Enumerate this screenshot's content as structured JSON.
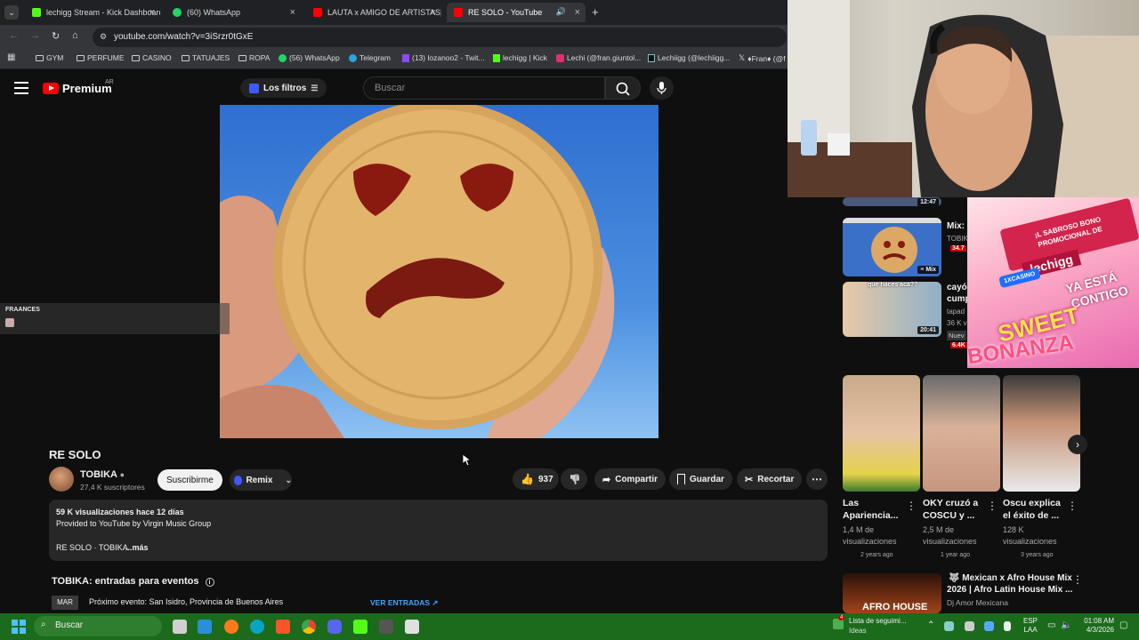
{
  "browser": {
    "tabs": [
      {
        "label": "lechigg Stream - Kick Dashboard"
      },
      {
        "label": "(60) WhatsApp"
      },
      {
        "label": "LAUTA x AMIGO DE ARTISTAS|"
      },
      {
        "label": "RE SOLO - YouTube"
      }
    ],
    "url": "youtube.com/watch?v=3iSrzr0tGxE",
    "bookmarks": [
      "GYM",
      "PERFUME",
      "CASINO",
      "TATUAJES",
      "ROPA",
      "(56) WhatsApp",
      "Telegram",
      "(13) lozanoo2 - Twit...",
      "lechigg | Kick",
      "Lechi (@fran.giuntol...",
      "Lechiigg (@lechiigg...",
      "♦Fran♦ (@f"
    ]
  },
  "youtube": {
    "logo": "Premium",
    "country": "AR",
    "filters_label": "Los filtros",
    "search_placeholder": "Buscar"
  },
  "chat": {
    "username": "FRAANCES"
  },
  "video": {
    "title": "RE SOLO",
    "channel": "TOBIKA",
    "subscribers": "27,4 K suscriptores",
    "subscribe_label": "Suscribirme",
    "remix_label": "Remix",
    "likes": "937",
    "share_label": "Compartir",
    "save_label": "Guardar",
    "clip_label": "Recortar",
    "description": {
      "views_date": "59 K visualizaciones  hace 12 días",
      "provided": "Provided to YouTube by Virgin Music Group",
      "line2": "RE SOLO · TOBIKA",
      "more": "...más"
    }
  },
  "events": {
    "heading": "TOBIKA: entradas para eventos",
    "month": "MAR",
    "event": "Próximo evento: San Isidro, Provincia de Buenos Aires",
    "tickets": "VER ENTRADAS ↗"
  },
  "sidebar": {
    "top_duration": "12:47",
    "mix": {
      "title": "Mix: F",
      "channel": "TOBIK",
      "badge": "34.7",
      "thumb_label": "Mix"
    },
    "item2": {
      "title_line1": "cayó",
      "title_line2": "cump",
      "channel": "tapad",
      "meta": "36 K v",
      "badge": "Nuev",
      "badge2": "6.4K",
      "duration": "20:41",
      "caption": "que haces acá??"
    },
    "shorts": [
      {
        "title_line1": "Las",
        "title_line2": "Apariencia...",
        "views_line1": "1,4 M de",
        "views_line2": "visualizaciones",
        "date": "2 years ago"
      },
      {
        "title_line1": "OKY cruzó a",
        "title_line2": "COSCU y ...",
        "views_line1": "2,5 M de",
        "views_line2": "visualizaciones",
        "date": "1 year ago"
      },
      {
        "title_line1": "Oscu explica",
        "title_line2": "el éxito de ...",
        "views_line1": "128 K",
        "views_line2": "visualizaciones",
        "date": "3 years ago"
      }
    ],
    "bottom": {
      "title_line1": "Mexican x Afro House Mix",
      "title_line2": "2026 | Afro Latin House Mix ...",
      "channel": "Dj Amor Mexicana",
      "thumb_text": "AFRO HOUSE"
    }
  },
  "ad": {
    "line1": "¡L SABROSO BONO",
    "line2": "PROMOCIONAL DE",
    "name": "lechigg",
    "line3": "YA ESTÁ",
    "line4": "CONTIGO",
    "brand": "1XCASINO",
    "game1": "SWEET",
    "game2": "BONANZA"
  },
  "taskbar": {
    "search": "Buscar",
    "widget_line1": "Lista de seguimi...",
    "widget_line2": "Ideas",
    "widget_badge": "4",
    "lang1": "ESP",
    "lang2": "LAA",
    "time": "01:08 AM",
    "date": "4/3/2026"
  }
}
